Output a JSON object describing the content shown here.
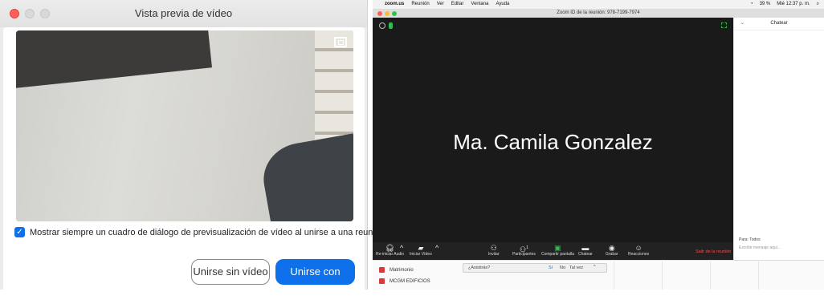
{
  "dialog": {
    "title": "Vista previa de vídeo",
    "checkbox_label": "Mostrar siempre un cuadro de diálogo de previsualización de vídeo al unirse a una reunión con vídeo",
    "checkbox_checked": true,
    "btn_no_video": "Unirse sin vídeo",
    "btn_video": "Unirse con vídeo",
    "accent_color": "#0e71eb"
  },
  "zoom": {
    "menubar": {
      "apple": "",
      "app": "zoom.us",
      "items": [
        "Reunión",
        "Ver",
        "Editar",
        "Ventana",
        "Ayuda"
      ],
      "battery": "39 %",
      "clock": "Mié 12:37 p. m."
    },
    "window_title": "Zoom ID de la reunión: 978-7199-7974",
    "participant_name": "Ma. Camila Gonzalez",
    "toolbar": {
      "audio": "Re-iniciar Audio",
      "video": "Iniciar Vídeo",
      "invite": "Invitar",
      "participants": "Participantes",
      "participants_count": "1",
      "share": "Compartir pantalla",
      "chat": "Chatear",
      "record": "Grabar",
      "reactions": "Reacciones",
      "end": "Salir de la reunión"
    },
    "chat": {
      "title": "Chatear",
      "to": "Para: Todos",
      "placeholder": "Escribir mensaje aquí..."
    },
    "taskbar": {
      "rows": [
        "Matrimonio",
        "MCGM EDIFICIOS"
      ],
      "popup_question": "¿Asistirás?",
      "popup_yes": "Sí",
      "popup_no": "No",
      "popup_maybe": "Tal vez"
    }
  }
}
